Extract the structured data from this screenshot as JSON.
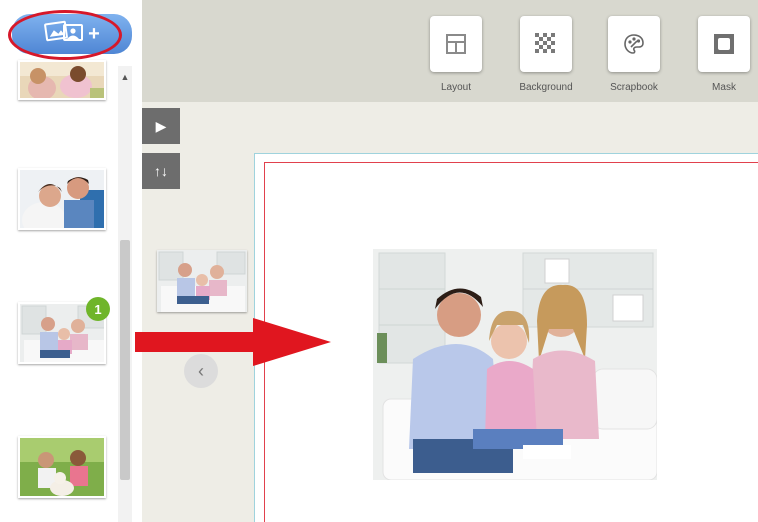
{
  "toolbar": {
    "tools": [
      {
        "label": "Layout",
        "icon": "layout-icon"
      },
      {
        "label": "Background",
        "icon": "checkerboard-icon"
      },
      {
        "label": "Scrapbook",
        "icon": "palette-icon"
      },
      {
        "label": "Mask",
        "icon": "mask-icon"
      }
    ]
  },
  "sidebar": {
    "add_button_icon": "add-photos-icon",
    "add_button_symbol": "+",
    "scroll_up_symbol": "▲",
    "photos": [
      {
        "name": "family-playing-photo"
      },
      {
        "name": "couple-hugging-photo"
      },
      {
        "name": "family-on-sofa-photo",
        "badge": "1"
      },
      {
        "name": "family-outdoors-dog-photo"
      }
    ]
  },
  "workspace": {
    "expand_symbol": "▶",
    "swap_symbol": "↑↓",
    "prev_symbol": "‹"
  },
  "colors": {
    "toolbar_bg": "#d8d8cf",
    "workspace_bg": "#eeede6",
    "accent_blue": "#4f86d4",
    "callout_red": "#d6182a",
    "badge_green": "#6fb52a"
  }
}
